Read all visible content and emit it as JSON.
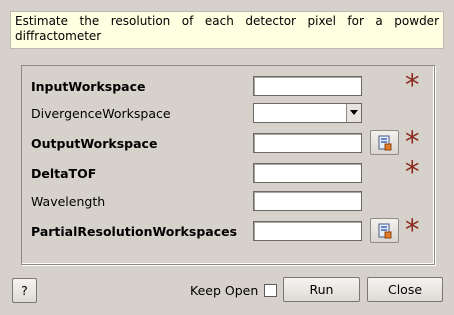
{
  "description": "Estimate the resolution of each detector pixel for a powder diffractometer",
  "fields": [
    {
      "label": "InputWorkspace",
      "value": "",
      "required": true
    },
    {
      "label": "DivergenceWorkspace",
      "value": "",
      "required": false
    },
    {
      "label": "OutputWorkspace",
      "value": "",
      "required": true
    },
    {
      "label": "DeltaTOF",
      "value": "",
      "required": true
    },
    {
      "label": "Wavelength",
      "value": "",
      "required": false
    },
    {
      "label": "PartialResolutionWorkspaces",
      "value": "",
      "required": true
    }
  ],
  "required_marker": "*",
  "footer": {
    "help_label": "?",
    "keep_open_label": "Keep Open",
    "keep_open_checked": false,
    "run_label": "Run",
    "close_label": "Close"
  },
  "colors": {
    "window_bg": "#d6d2cb",
    "description_bg": "#ffffe1",
    "required_star": "#8b2a1d"
  },
  "icons": {
    "browse": "workspace-browse-icon",
    "dropdown": "chevron-down-icon"
  }
}
